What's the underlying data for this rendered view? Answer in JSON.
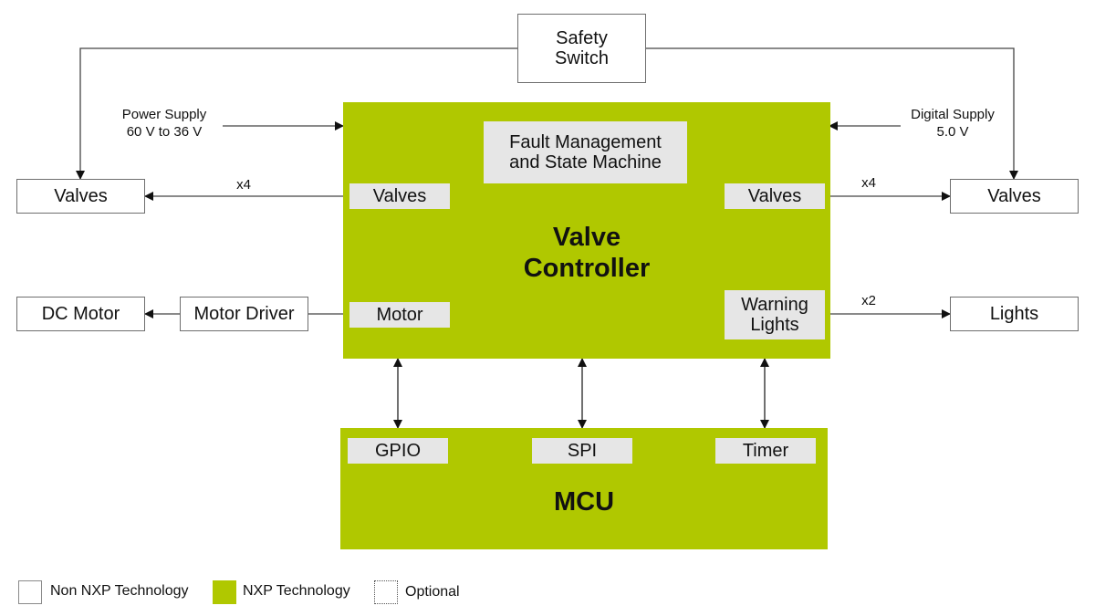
{
  "colors": {
    "nxp_green": "#b0c800",
    "sub_block": "#e6e6e6",
    "line": "#333333",
    "border": "#6e6e6e"
  },
  "external": {
    "safety_switch": "Safety\nSwitch",
    "valves_left": "Valves",
    "valves_right": "Valves",
    "dc_motor": "DC Motor",
    "motor_driver": "Motor Driver",
    "lights": "Lights"
  },
  "supplies": {
    "power": {
      "line1": "Power Supply",
      "line2": "60 V to 36 V"
    },
    "digital": {
      "line1": "Digital Supply",
      "line2": "5.0 V"
    }
  },
  "multipliers": {
    "valves_left": "x4",
    "valves_right": "x4",
    "lights": "x2"
  },
  "valve_controller": {
    "title_line1": "Valve",
    "title_line2": "Controller",
    "fault_line1": "Fault Management",
    "fault_line2": "and State Machine",
    "valves_left": "Valves",
    "valves_right": "Valves",
    "motor": "Motor",
    "warning_line1": "Warning",
    "warning_line2": "Lights"
  },
  "mcu": {
    "title": "MCU",
    "gpio": "GPIO",
    "spi": "SPI",
    "timer": "Timer"
  },
  "legend": [
    {
      "label": "Non NXP Technology",
      "style": "non-nxp"
    },
    {
      "label": "NXP Technology",
      "style": "nxp"
    },
    {
      "label": "Optional",
      "style": "optional"
    }
  ]
}
